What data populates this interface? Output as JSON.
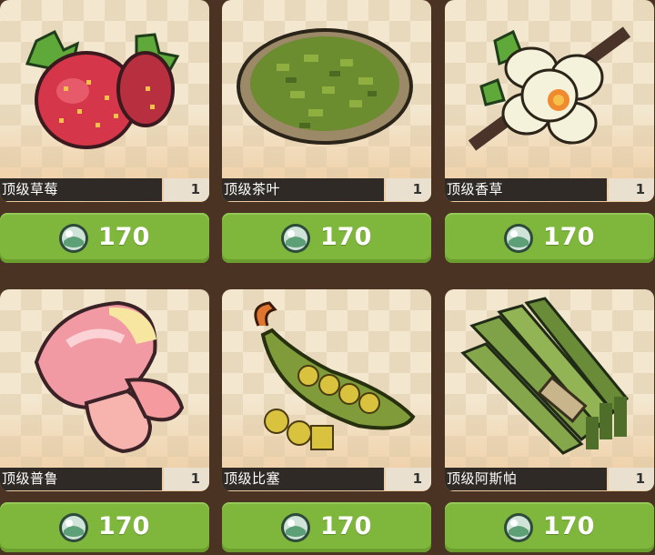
{
  "shop": {
    "items": [
      {
        "name": "顶级草莓",
        "quantity": "1",
        "price": "170",
        "icon": "strawberry-icon"
      },
      {
        "name": "顶级茶叶",
        "quantity": "1",
        "price": "170",
        "icon": "tea-leaf-bowl-icon"
      },
      {
        "name": "顶级香草",
        "quantity": "1",
        "price": "170",
        "icon": "vanilla-flower-icon"
      },
      {
        "name": "顶级普鲁",
        "quantity": "1",
        "price": "170",
        "icon": "pink-mushroom-icon"
      },
      {
        "name": "顶级比塞",
        "quantity": "1",
        "price": "170",
        "icon": "pea-pod-icon"
      },
      {
        "name": "顶级阿斯帕",
        "quantity": "1",
        "price": "170",
        "icon": "asparagus-bundle-icon"
      }
    ],
    "currency_icon": "gem-orb-icon",
    "colors": {
      "button": "#7fb73c",
      "name_bar": "#2f2a26",
      "background": "#4a3322"
    }
  }
}
